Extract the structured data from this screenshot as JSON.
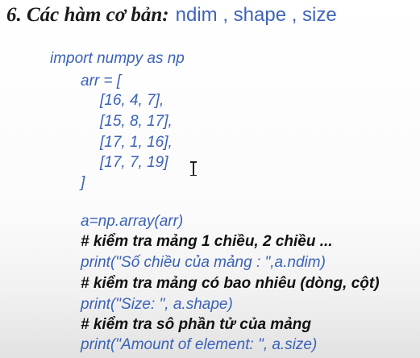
{
  "heading": {
    "title": "6. Các hàm cơ bản:",
    "functions": "ndim , shape , size"
  },
  "code": {
    "import": "import numpy as np",
    "arr_open": "arr = [",
    "rows": [
      "[16, 4, 7],",
      "[15, 8, 17],",
      "[17, 1, 16],",
      "[17, 7, 19]"
    ],
    "arr_close": "]",
    "array_call": "a=np.array(arr)",
    "comment_1": "# kiểm tra mảng 1 chiều, 2 chiều ...",
    "print_ndim": "print(\"Số chiều của mảng : \",a.ndim)",
    "comment_2": "# kiểm tra mảng có bao nhiêu (dòng, cột)",
    "print_shape": "print(\"Size: \", a.shape)",
    "comment_3": "# kiểm tra sô phần tử của mảng",
    "print_size": "print(\"Amount of element: \", a.size)"
  },
  "colors": {
    "code": "#3a62b8",
    "comment": "#111111",
    "heading": "#1b1b1b"
  }
}
